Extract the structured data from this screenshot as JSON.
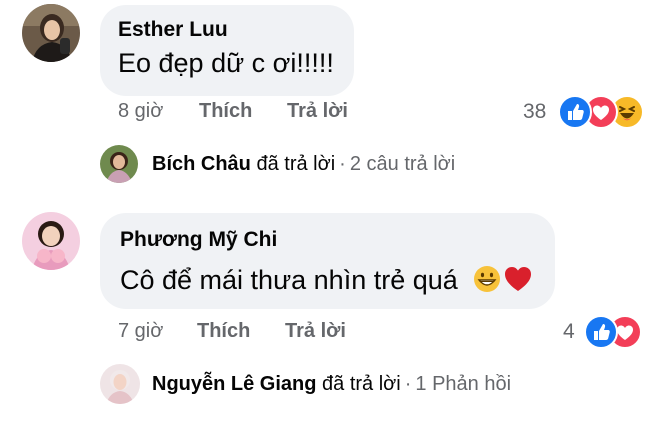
{
  "comments": [
    {
      "author": "Esther Luu",
      "text": "Eo đẹp dữ c ơi!!!!!",
      "time": "8 giờ",
      "like_label": "Thích",
      "reply_label": "Trả lời",
      "reaction_count": "38",
      "reactions": [
        "like-icon",
        "love-icon",
        "haha-icon"
      ],
      "reply_summary": {
        "replier": "Bích Châu",
        "verb": "đã trả lời",
        "count_text": "2 câu trả lời"
      }
    },
    {
      "author": "Phương Mỹ Chi",
      "text": "Cô để mái thưa nhìn trẻ quá",
      "emoji": [
        "grin-emoji",
        "red-heart-emoji"
      ],
      "time": "7 giờ",
      "like_label": "Thích",
      "reply_label": "Trả lời",
      "reaction_count": "4",
      "reactions": [
        "like-icon",
        "love-icon"
      ],
      "reply_summary": {
        "replier": "Nguyễn Lê Giang",
        "verb": "đã trả lời",
        "count_text": "1 Phản hồi"
      }
    }
  ],
  "colors": {
    "bubble": "#f0f2f5",
    "meta_text": "#65676b",
    "like_blue": "#1877f2",
    "love_red": "#f33e58",
    "haha_yellow": "#f7b928"
  }
}
